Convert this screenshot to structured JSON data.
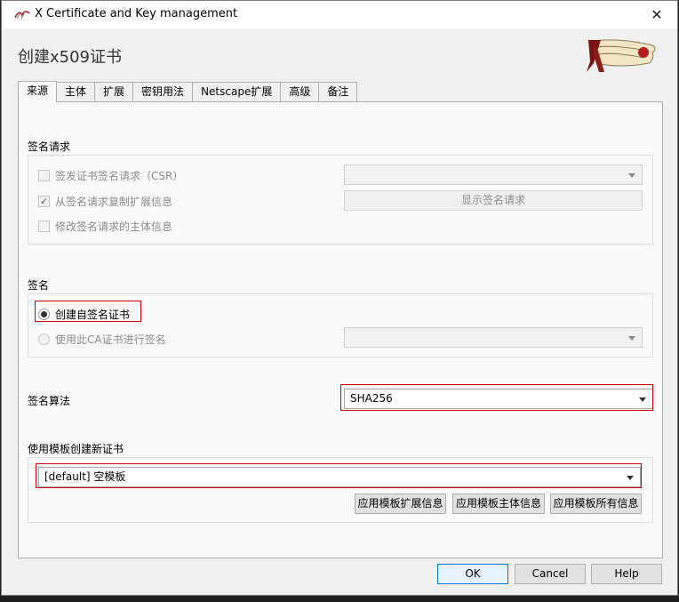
{
  "window": {
    "title": "X Certificate and Key management",
    "close_glyph": "✕"
  },
  "heading": "创建x509证书",
  "tabs": [
    {
      "label": "来源",
      "active": true
    },
    {
      "label": "主体",
      "active": false
    },
    {
      "label": "扩展",
      "active": false
    },
    {
      "label": "密钥用法",
      "active": false
    },
    {
      "label": "Netscape扩展",
      "active": false
    },
    {
      "label": "高级",
      "active": false
    },
    {
      "label": "备注",
      "active": false
    }
  ],
  "signing_request": {
    "label": "签名请求",
    "sign_csr": {
      "label": "签发证书签名请求（CSR）",
      "checked": false,
      "enabled": false
    },
    "copy_ext": {
      "label": "从签名请求复制扩展信息",
      "checked": true,
      "enabled": false
    },
    "modify_subject": {
      "label": "修改签名请求的主体信息",
      "checked": false,
      "enabled": false
    },
    "csr_select_value": "",
    "show_request_button": "显示签名请求"
  },
  "signing": {
    "label": "签名",
    "self_signed": {
      "label": "创建自签名证书",
      "selected": true
    },
    "use_ca": {
      "label": "使用此CA证书进行签名",
      "selected": false,
      "enabled": false
    },
    "ca_select_value": ""
  },
  "algorithm": {
    "label": "签名算法",
    "value": "SHA256"
  },
  "template": {
    "label": "使用模板创建新证书",
    "value": "[default] 空模板",
    "apply_extensions": "应用模板扩展信息",
    "apply_subject": "应用模板主体信息",
    "apply_all": "应用模板所有信息"
  },
  "footer": {
    "ok": "OK",
    "cancel": "Cancel",
    "help": "Help"
  },
  "colors": {
    "highlight_box": "#d00000",
    "default_button_border": "#0078d7",
    "logo_red": "#8b1a1a"
  },
  "icons": {
    "app": "xca-app-icon",
    "logo": "xca-scroll-logo"
  }
}
